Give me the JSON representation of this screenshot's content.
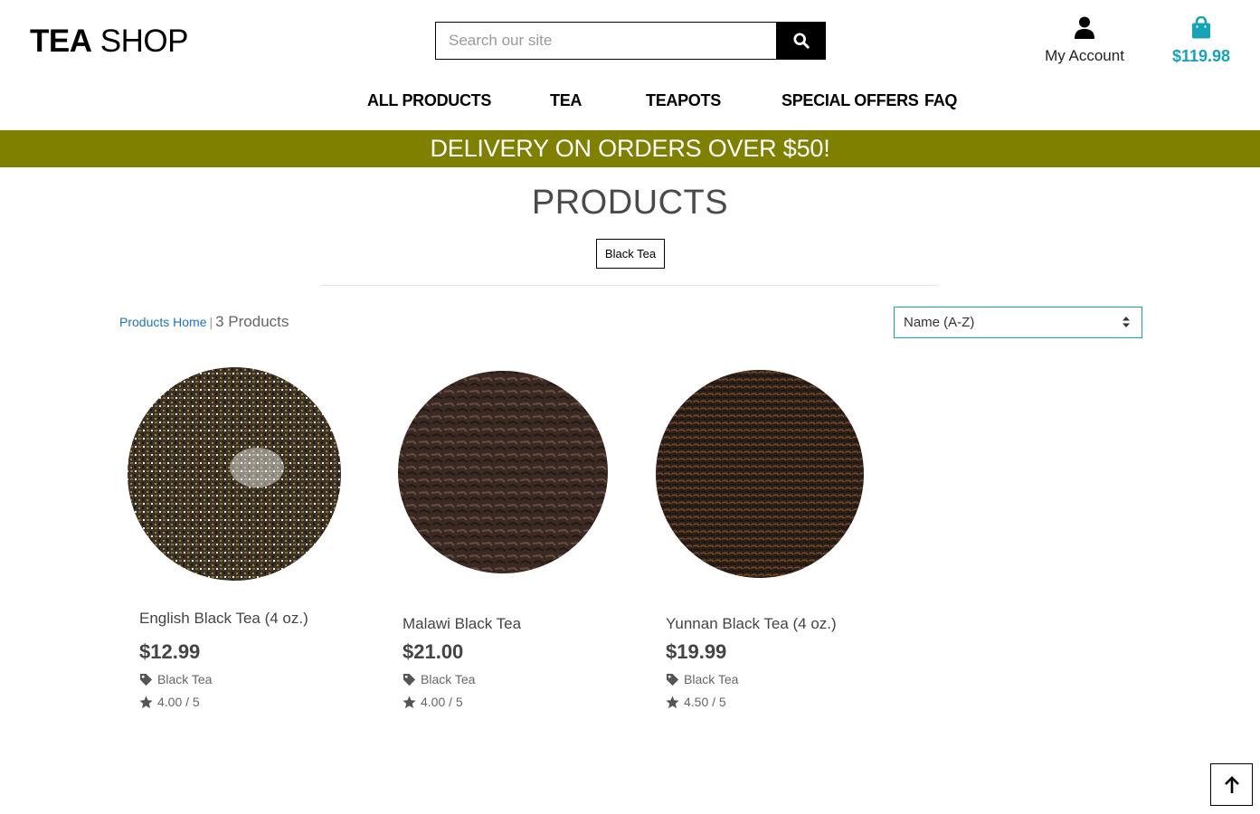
{
  "header": {
    "logo_bold": "TEA",
    "logo_light": "SHOP",
    "search_placeholder": "Search our site",
    "search_icon": "search-icon",
    "account_label": "My Account",
    "account_icon": "user-icon",
    "bag_icon": "shopping-bag-icon",
    "bag_total": "$119.98",
    "bag_color": "#17a2b8"
  },
  "nav": {
    "items": [
      "ALL PRODUCTS",
      "TEA",
      "TEAPOTS",
      "SPECIAL OFFERS",
      "FAQ"
    ]
  },
  "banner": {
    "text": "DELIVERY ON ORDERS OVER $50!",
    "color": "#7f7f00"
  },
  "main": {
    "title": "PRODUCTS",
    "category_chip": "Black Tea",
    "breadcrumb_home": "Products Home",
    "breadcrumb_separator": "|",
    "product_count": "3 Products",
    "sort_value": "Name (A-Z)"
  },
  "products": [
    {
      "name": "English Black Tea (4 oz.)",
      "price": "$12.99",
      "category": "Black Tea",
      "rating": "4.00 / 5"
    },
    {
      "name": "Malawi Black Tea",
      "price": "$21.00",
      "category": "Black Tea",
      "rating": "4.00 / 5"
    },
    {
      "name": "Yunnan Black Tea (4 oz.)",
      "price": "$19.99",
      "category": "Black Tea",
      "rating": "4.50 / 5"
    }
  ],
  "icons": {
    "tag": "tag-icon",
    "star": "star-icon",
    "back_to_top": "arrow-up-icon",
    "sort": "sort-arrows-icon"
  }
}
